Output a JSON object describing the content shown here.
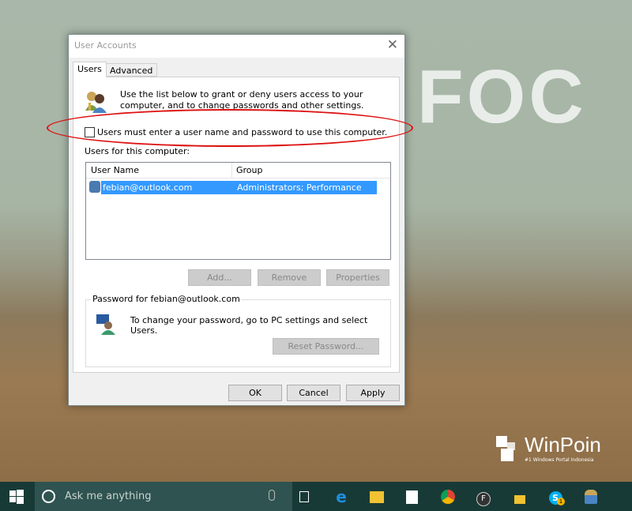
{
  "wallpaper": {
    "text": "FOC",
    "watermark": "WinPoin",
    "watermark_sub": "#1 Windows Portal Indonesia"
  },
  "dialog": {
    "title": "User Accounts",
    "tabs": [
      {
        "label": "Users",
        "active": true
      },
      {
        "label": "Advanced",
        "active": false
      }
    ],
    "intro": "Use the list below to grant or deny users access to your computer, and to change passwords and other settings.",
    "require_login_checkbox": {
      "label": "Users must enter a user name and password to use this computer.",
      "checked": false
    },
    "users_label": "Users for this computer:",
    "columns": [
      "User Name",
      "Group"
    ],
    "rows": [
      {
        "user": "febian@outlook.com",
        "group": "Administrators; Performance Log...",
        "selected": true
      }
    ],
    "buttons": {
      "add": "Add...",
      "remove": "Remove",
      "properties": "Properties",
      "reset": "Reset Password...",
      "ok": "OK",
      "cancel": "Cancel",
      "apply": "Apply"
    },
    "password_group": "Password for febian@outlook.com",
    "password_text": "To change your password, go to PC settings and select Users.",
    "highlight_color": "#dd1111"
  },
  "taskbar": {
    "search_placeholder": "Ask me anything",
    "skype_badge": "1",
    "chrome_icon": "chrome-icon"
  }
}
